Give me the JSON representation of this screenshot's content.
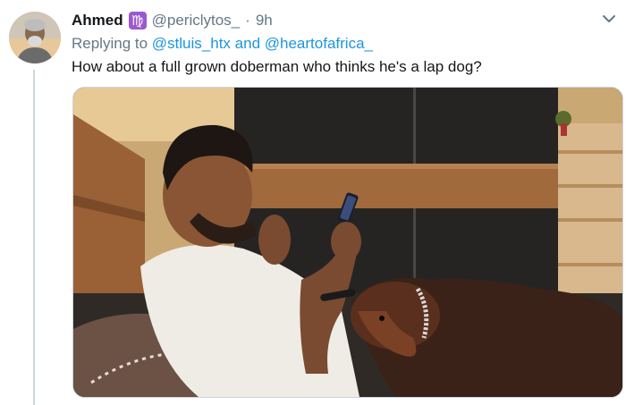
{
  "tweet": {
    "author_name": "Ahmed",
    "zodiac_glyph": "♍",
    "handle": "@periclytos_",
    "separator": "·",
    "time": "9h",
    "reply_prefix": "Replying to",
    "reply_to_1": "@stluis_htx",
    "reply_joiner": "and",
    "reply_to_2": "@heartofafrica_",
    "text": "How about a full grown doberman who thinks he's a lap dog?"
  },
  "icons": {
    "zodiac": "virgo-emoji-icon",
    "menu": "chevron-down-icon"
  },
  "colors": {
    "link": "#1b95e0",
    "meta": "#657786",
    "text": "#14171a",
    "zodiac_bg": "#9b59d0"
  }
}
